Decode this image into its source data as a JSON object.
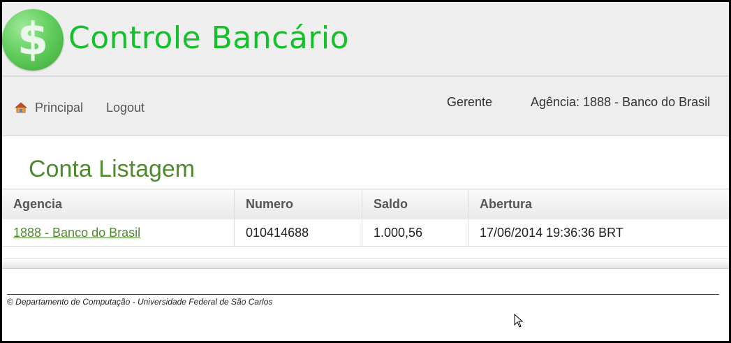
{
  "header": {
    "logo_symbol": "$",
    "logo_icon": "dollar-coin-icon",
    "title": "Controle Bancário",
    "title_color": "#13c22a"
  },
  "nav": {
    "home_icon": "home-icon",
    "principal_label": "Principal",
    "logout_label": "Logout",
    "role": "Gerente",
    "agencia": "Agência: 1888 - Banco do Brasil"
  },
  "main": {
    "title": "Conta Listagem",
    "table": {
      "headers": [
        "Agencia",
        "Numero",
        "Saldo",
        "Abertura"
      ],
      "rows": [
        {
          "agencia": "1888 - Banco do Brasil",
          "numero": "010414688",
          "saldo": "1.000,56",
          "abertura": "17/06/2014 19:36:36 BRT"
        }
      ]
    }
  },
  "footer": {
    "text": "© Departamento de Computação - Universidade Federal de São Carlos"
  },
  "accent_color": "#4f8a2e"
}
